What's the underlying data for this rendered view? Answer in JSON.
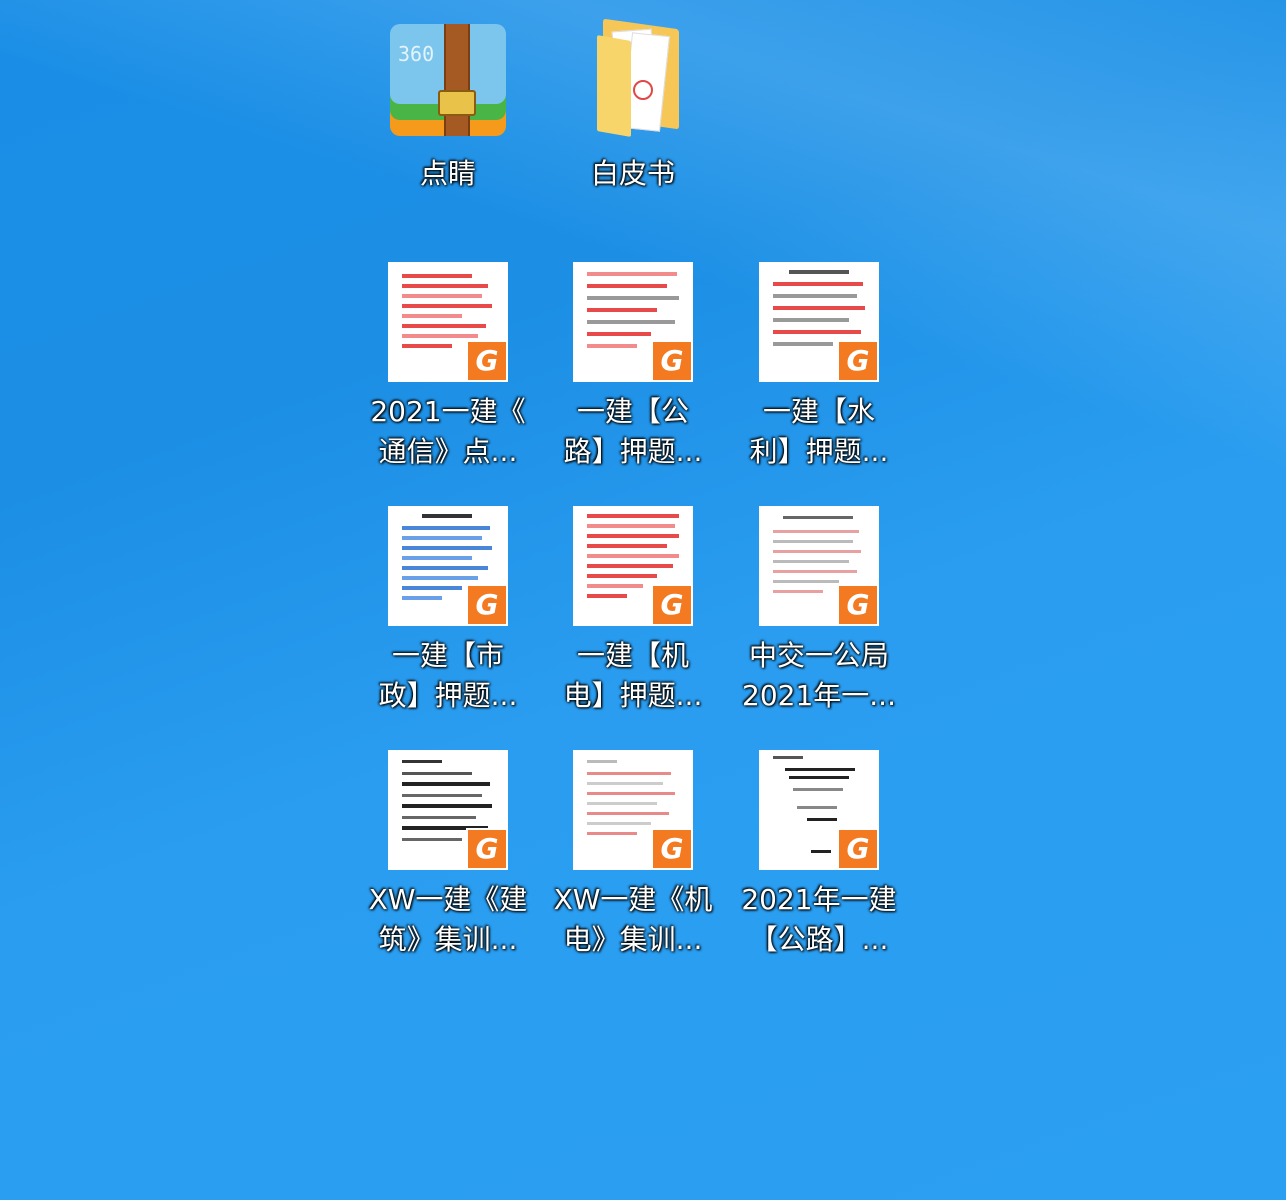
{
  "desktop": {
    "icons": [
      {
        "label": "点睛",
        "type": "archive",
        "icon": "archive-360zip-icon"
      },
      {
        "label": "白皮书",
        "type": "folder",
        "icon": "folder-icon"
      },
      {
        "label": "2021一建《\n通信》点...",
        "type": "pdf",
        "icon": "pdf-file-icon",
        "accent": "#e84a4a"
      },
      {
        "label": "一建【公\n路】押题...",
        "type": "pdf",
        "icon": "pdf-file-icon",
        "accent": "#e84a4a"
      },
      {
        "label": "一建【水\n利】押题...",
        "type": "pdf",
        "icon": "pdf-file-icon",
        "accent": "#e84a4a"
      },
      {
        "label": "一建【市\n政】押题...",
        "type": "pdf",
        "icon": "pdf-file-icon",
        "accent": "#4a86d8"
      },
      {
        "label": "一建【机\n电】押题...",
        "type": "pdf",
        "icon": "pdf-file-icon",
        "accent": "#e84a4a"
      },
      {
        "label": "中交一公局\n2021年一...",
        "type": "pdf",
        "icon": "pdf-file-icon",
        "accent": "#e8a0a0"
      },
      {
        "label": "XW一建《建\n筑》集训...",
        "type": "pdf",
        "icon": "pdf-file-icon",
        "accent": "#333333"
      },
      {
        "label": "XW一建《机\n电》集训...",
        "type": "pdf",
        "icon": "pdf-file-icon",
        "accent": "#e88a8a"
      },
      {
        "label": "2021年一建\n【公路】...",
        "type": "pdf",
        "icon": "pdf-file-icon",
        "accent": "#222222"
      }
    ],
    "pdf_badge_glyph": "G",
    "zip_badge_text": "360"
  }
}
